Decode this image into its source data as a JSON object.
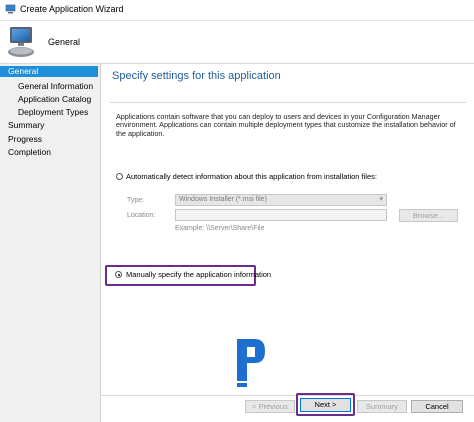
{
  "window": {
    "title": "Create Application Wizard"
  },
  "header": {
    "page_title": "General"
  },
  "nav": {
    "items": [
      {
        "label": "General",
        "selected": true
      },
      {
        "label": "General Information"
      },
      {
        "label": "Application Catalog"
      },
      {
        "label": "Deployment Types"
      },
      {
        "label": "Summary"
      },
      {
        "label": "Progress"
      },
      {
        "label": "Completion"
      }
    ]
  },
  "main": {
    "heading": "Specify settings for this application",
    "description": "Applications contain software that you can deploy to users and devices in your Configuration Manager environment. Applications can contain multiple deployment types that customize the installation behavior of the application.",
    "auto_detect": {
      "label": "Automatically detect information about this application from installation files:",
      "selected": false,
      "type_label": "Type:",
      "type_value": "Windows Installer (*.msi file)",
      "location_label": "Location:",
      "location_value": "",
      "browse_label": "Browse...",
      "example_text": "Example: \\\\Server\\Share\\File"
    },
    "manual": {
      "label": "Manually specify the application information",
      "selected": true
    }
  },
  "footer": {
    "previous_label": "< Previous",
    "next_label": "Next >",
    "summary_label": "Summary",
    "cancel_label": "Cancel"
  },
  "watermark": {
    "letter": "P"
  },
  "colors": {
    "accent": "#1e8fd9",
    "heading": "#1f5d9c",
    "highlight": "#6b2d8c"
  }
}
